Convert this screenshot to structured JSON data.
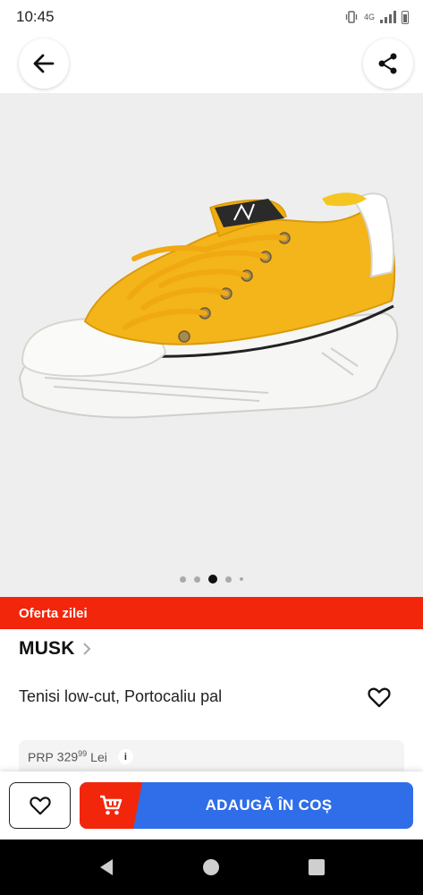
{
  "status_bar": {
    "time": "10:45",
    "network": "4G"
  },
  "header": {
    "back_icon": "arrow-left-icon",
    "share_icon": "share-icon"
  },
  "gallery": {
    "image_name": "yellow-low-cut-sneaker",
    "dot_count": 5,
    "active_index": 2
  },
  "offer": {
    "label": "Oferta zilei",
    "color": "#f2260a"
  },
  "product": {
    "brand": "MUSK",
    "title": "Tenisi low-cut, Portocaliu pal",
    "price": {
      "prefix": "PRP",
      "whole": "329",
      "decimals": "99",
      "currency": "Lei",
      "info": "i"
    }
  },
  "actions": {
    "add_to_cart_label": "ADAUGĂ ÎN COȘ",
    "primary_color": "#2f6ee8",
    "accent_color": "#f2260a"
  }
}
